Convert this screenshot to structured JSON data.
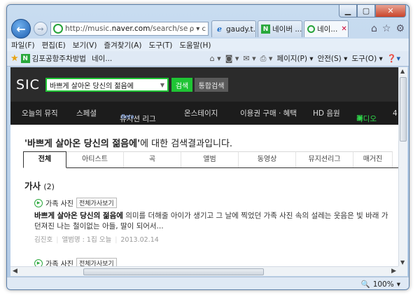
{
  "browser": {
    "address_url_host": "http://music.",
    "address_url_bold": "naver.com",
    "address_url_rest": "/search/sea",
    "address_controls": "ρ ▾ c",
    "tabs": [
      {
        "label": "gaudy.t...",
        "icon": "ie-icon"
      },
      {
        "label": "네이버 ...",
        "icon": "naver-n-icon"
      },
      {
        "label": "네이...",
        "icon": "naver-music-icon"
      }
    ],
    "menu": [
      "파일(F)",
      "편집(E)",
      "보기(V)",
      "즐겨찾기(A)",
      "도구(T)",
      "도움말(H)"
    ],
    "favorites": [
      "김포공항주차방법",
      "네이..."
    ],
    "commands": [
      "페이지(P) ▾",
      "안전(S) ▾",
      "도구(O) ▾"
    ],
    "zoom": "100%"
  },
  "site": {
    "logo": "SIC",
    "search_value": "바쁘게 살아온 당신의 젊음에",
    "search_button": "검색",
    "total_search_button": "통합검색",
    "gnb": [
      "오늘의 뮤직",
      "스페셜",
      "뮤지션 리그",
      "온스테이지",
      "이용권 구매 · 혜택",
      "HD 음원",
      "라디오",
      "4"
    ],
    "gnb_beta": "Beta",
    "result_query": "'바쁘게 살아온 당신의 젊음에'",
    "result_suffix": "에 대한 검색결과입니다.",
    "subtabs": [
      "전체",
      "아티스트",
      "곡",
      "앨범",
      "동영상",
      "뮤지션리그",
      "매거진"
    ],
    "section_title": "가사",
    "section_count": "(2)",
    "items": [
      {
        "song": "가족 사진",
        "badge": "전체가사보기",
        "lyric_bold": "바쁘게 살아온 당신의 젊음에",
        "lyric_rest": " 의미를 더해줄 아이가 생기고 그 날에 찍었던 가족 사진 속의 설레는 웃음은 빛 바래 가",
        "lyric_line2": "던져진 나는 철이없는 아들, 딸이 되어서...",
        "artist": "김진호",
        "album": "앨범명 : 1집 오늘",
        "date": "2013.02.14"
      },
      {
        "song": "가족 사진",
        "badge": "전체가사보기"
      }
    ]
  }
}
